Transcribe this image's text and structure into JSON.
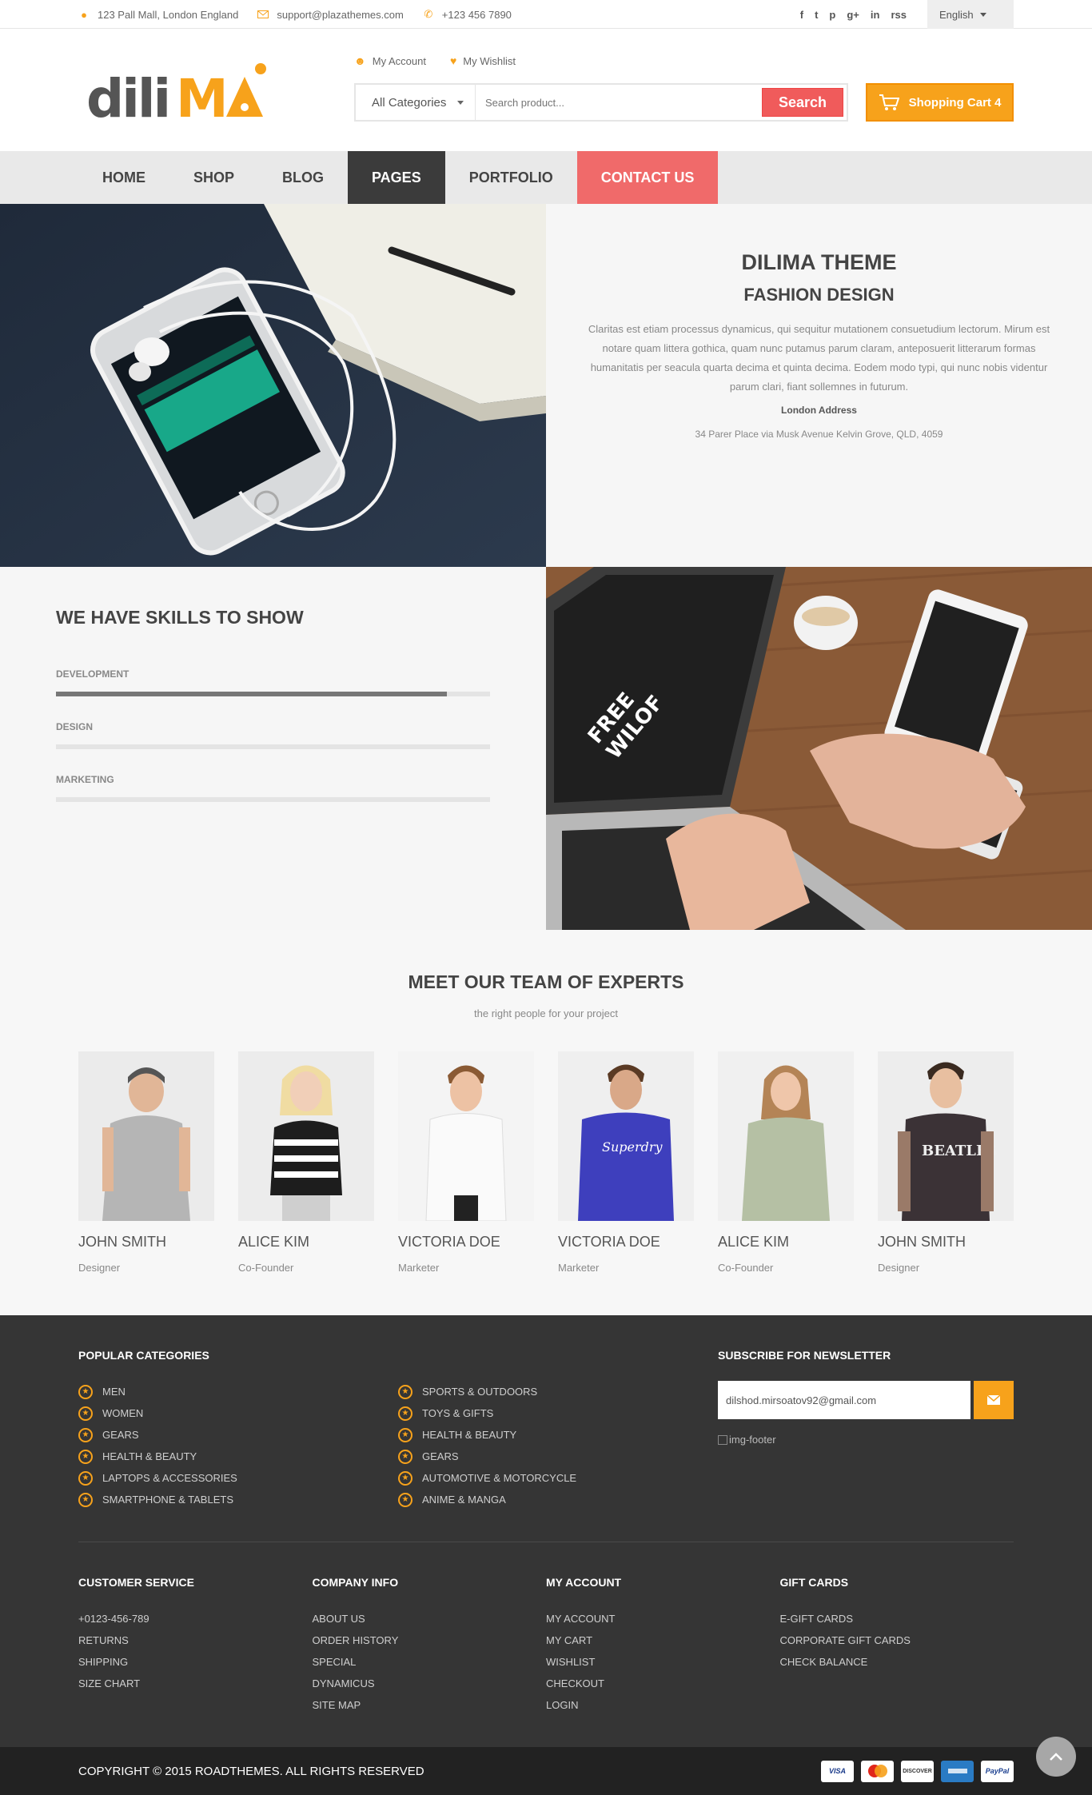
{
  "topbar": {
    "address": "123 Pall Mall, London England",
    "email": "support@plazathemes.com",
    "phone": "+123 456 7890",
    "language": "English",
    "social": [
      "f",
      "t",
      "p",
      "g+",
      "in",
      "rss"
    ]
  },
  "header": {
    "logo_text": "diliMA",
    "my_account": "My Account",
    "my_wishlist": "My Wishlist",
    "category_select": "All Categories",
    "search_placeholder": "Search product...",
    "search_button": "Search",
    "cart_label": "Shopping Cart 4"
  },
  "nav": {
    "items": [
      "HOME",
      "SHOP",
      "BLOG",
      "PAGES",
      "PORTFOLIO",
      "CONTACT US"
    ],
    "active": "PAGES"
  },
  "about": {
    "title": "DILIMA THEME",
    "subtitle": "FASHION DESIGN",
    "body": "Claritas est etiam processus dynamicus, qui sequitur mutationem consuetudium lectorum. Mirum est notare quam littera gothica, quam nunc putamus parum claram, anteposuerit litterarum formas humanitatis per seacula quarta decima et quinta decima. Eodem modo typi, qui nunc nobis videntur parum clari, fiant sollemnes in futurum.",
    "address_heading": "London Address",
    "address": "34 Parer Place via Musk Avenue Kelvin Grove, QLD, 4059"
  },
  "skills": {
    "title": "WE HAVE SKILLS TO SHOW",
    "items": [
      {
        "label": "DEVELOPMENT",
        "percent": 90
      },
      {
        "label": "DESIGN",
        "percent": 0
      },
      {
        "label": "MARKETING",
        "percent": 0
      }
    ]
  },
  "team": {
    "title": "MEET OUR TEAM OF EXPERTS",
    "subtitle": "the right people for your project",
    "members": [
      {
        "name": "JOHN SMITH",
        "role": "Designer"
      },
      {
        "name": "ALICE KIM",
        "role": "Co-Founder"
      },
      {
        "name": "VICTORIA DOE",
        "role": "Marketer"
      },
      {
        "name": "VICTORIA DOE",
        "role": "Marketer"
      },
      {
        "name": "ALICE KIM",
        "role": "Co-Founder"
      },
      {
        "name": "JOHN SMITH",
        "role": "Designer"
      }
    ]
  },
  "footer": {
    "popular_title": "POPULAR CATEGORIES",
    "popular_col1": [
      "MEN",
      "WOMEN",
      "GEARS",
      "HEALTH & BEAUTY",
      "LAPTOPS & ACCESSORIES",
      "SMARTPHONE & TABLETS"
    ],
    "popular_col2": [
      "SPORTS & OUTDOORS",
      "TOYS & GIFTS",
      "HEALTH & BEAUTY",
      "GEARS",
      "AUTOMOTIVE & MOTORCYCLE",
      "ANIME & MANGA"
    ],
    "newsletter_title": "SUBSCRIBE FOR NEWSLETTER",
    "newsletter_value": "dilshod.mirsoatov92@gmail.com",
    "footer_img_alt": "img-footer",
    "columns": [
      {
        "title": "CUSTOMER SERVICE",
        "links": [
          "+0123-456-789",
          "RETURNS",
          "SHIPPING",
          "SIZE CHART"
        ]
      },
      {
        "title": "COMPANY INFO",
        "links": [
          "ABOUT US",
          "ORDER HISTORY",
          "SPECIAL",
          "DYNAMICUS",
          "SITE MAP"
        ]
      },
      {
        "title": "MY ACCOUNT",
        "links": [
          "MY ACCOUNT",
          "MY CART",
          "WISHLIST",
          "CHECKOUT",
          "LOGIN"
        ]
      },
      {
        "title": "GIFT CARDS",
        "links": [
          "E-GIFT CARDS",
          "CORPORATE GIFT CARDS",
          "CHECK BALANCE"
        ]
      }
    ],
    "copyright": "COPYRIGHT © 2015 ROADTHEMES. ALL RIGHTS RESERVED",
    "payments": [
      "VISA",
      "MasterCard",
      "DISCOVER",
      "AMERICAN EXPRESS",
      "PayPal"
    ]
  },
  "colors": {
    "accent": "#f7a21b",
    "red": "#f05b5b",
    "dark": "#353535"
  }
}
